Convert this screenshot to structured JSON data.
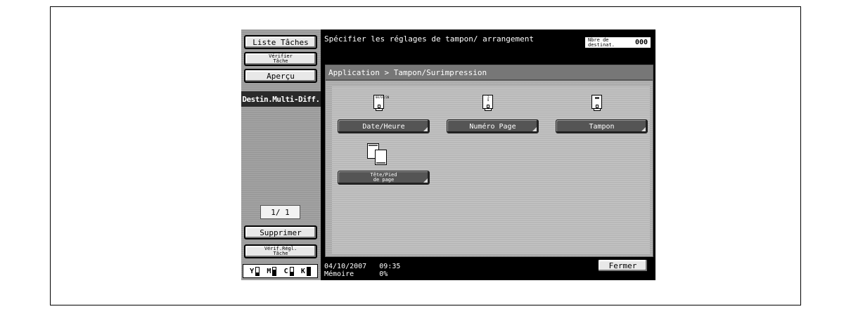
{
  "sidebar": {
    "liste_taches": "Liste Tâches",
    "verifier_tache_line1": "Vérifier",
    "verifier_tache_line2": "Tâche",
    "apercu": "Aperçu",
    "destin_multi": "Destin.Multi-Diff.",
    "page_indicator": "1/ 1",
    "supprimer": "Supprimer",
    "verif_regl_line1": "Vérif.Régl.",
    "verif_regl_line2": "Tâche",
    "toner": [
      {
        "label": "Y",
        "level": 0.35
      },
      {
        "label": "M",
        "level": 0.65
      },
      {
        "label": "C",
        "level": 0.45
      },
      {
        "label": "K",
        "level": 0.95
      }
    ]
  },
  "header": {
    "title": "Spécifier les réglages de tampon/ arrangement",
    "dest_label_line1": "Nbre de",
    "dest_label_line2": "destinat.",
    "dest_value": "000"
  },
  "main": {
    "breadcrumb": "Application > Tampon/Surimpression",
    "icon_marks": {
      "date": "08/01/20",
      "page": "2-8"
    },
    "options": {
      "date_heure": "Date/Heure",
      "numero_page": "Numéro Page",
      "tampon": "Tampon",
      "tete_pied_line1": "Tête/Pied",
      "tete_pied_line2": "de page"
    }
  },
  "footer": {
    "date": "04/10/2007",
    "time": "09:35",
    "memoire_label": "Mémoire",
    "memoire_value": "0%",
    "fermer": "Fermer"
  }
}
